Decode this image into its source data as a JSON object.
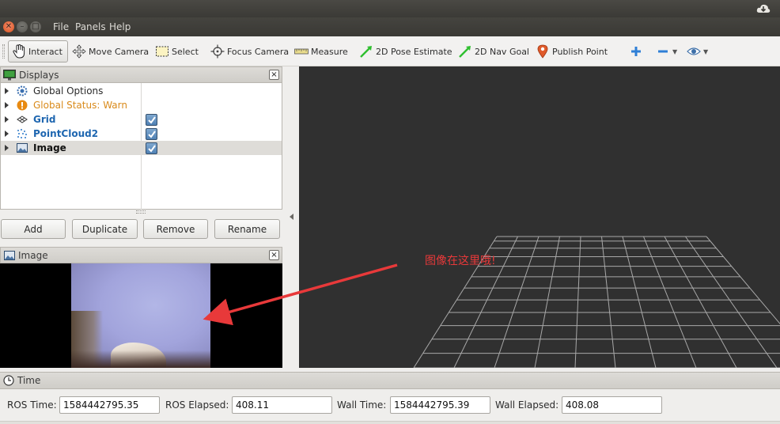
{
  "menubar": {
    "items": [
      "File",
      "Panels",
      "Help"
    ]
  },
  "toolbar": {
    "tools": [
      {
        "label": "Interact",
        "icon": "hand-icon",
        "active": true
      },
      {
        "label": "Move Camera",
        "icon": "move-camera-icon"
      },
      {
        "label": "Select",
        "icon": "select-icon"
      },
      {
        "label": "Focus Camera",
        "icon": "focus-camera-icon"
      },
      {
        "label": "Measure",
        "icon": "ruler-icon"
      },
      {
        "label": "2D Pose Estimate",
        "icon": "pose-arrow-icon"
      },
      {
        "label": "2D Nav Goal",
        "icon": "nav-goal-arrow-icon"
      },
      {
        "label": "Publish Point",
        "icon": "map-pin-icon"
      }
    ]
  },
  "displays": {
    "title": "Displays",
    "items": [
      {
        "label": "Global Options",
        "icon": "gear-icon",
        "style": "normal",
        "checked": null
      },
      {
        "label": "Global Status: Warn",
        "icon": "warning-icon",
        "style": "warn",
        "checked": null
      },
      {
        "label": "Grid",
        "icon": "grid-icon",
        "style": "blue",
        "checked": true
      },
      {
        "label": "PointCloud2",
        "icon": "pointcloud-icon",
        "style": "blue",
        "checked": true
      },
      {
        "label": "Image",
        "icon": "image-icon",
        "style": "bold",
        "checked": true,
        "selected": true
      }
    ],
    "buttons": {
      "add": "Add",
      "duplicate": "Duplicate",
      "remove": "Remove",
      "rename": "Rename"
    }
  },
  "image_panel": {
    "title": "Image"
  },
  "view3d": {
    "annotation": "图像在这里哦!"
  },
  "time_panel": {
    "title": "Time",
    "ros_time_label": "ROS Time:",
    "ros_time": "1584442795.35",
    "ros_elapsed_label": "ROS Elapsed:",
    "ros_elapsed": "408.11",
    "wall_time_label": "Wall Time:",
    "wall_time": "1584442795.39",
    "wall_elapsed_label": "Wall Elapsed:",
    "wall_elapsed": "408.08"
  },
  "colors": {
    "accent_blue": "#1e66b0",
    "warn_orange": "#d98a1a",
    "annotation_red": "#e8393a",
    "view_background": "#303030"
  }
}
